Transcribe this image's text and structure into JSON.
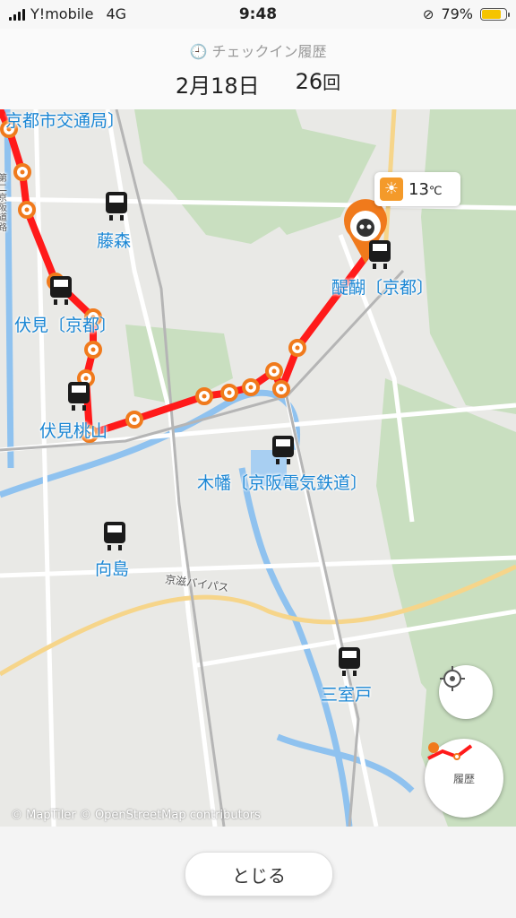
{
  "status": {
    "carrier": "Y!mobile",
    "network": "4G",
    "time": "9:48",
    "battery": "79%",
    "battery_level": 0.79
  },
  "header": {
    "subtitle": "チェックイン履歴",
    "date": "2月18日",
    "count": "26",
    "count_unit": "回"
  },
  "map": {
    "labels": {
      "kyoto_kotsu": "京都市交通局〕",
      "fujinomori": "藤森",
      "fushimi_kyoto": "伏見〔京都〕",
      "fushimi_momoyama": "伏見桃山",
      "daigo": "醍醐〔京都〕",
      "kowata": "木幡〔京阪電気鉄道〕",
      "mukaijima": "向島",
      "mimurodo": "三室戸",
      "bypass": "京滋バイパス",
      "road_side": "第二京阪道路"
    },
    "weather": {
      "icon": "sun-icon",
      "temperature": "13",
      "unit": "℃"
    },
    "route_color": "#ff1a1a",
    "marker_color": "#f07a1c",
    "attribution": "© MapTiler © OpenStreetMap contributors",
    "history_button_label": "履歴"
  },
  "footer": {
    "close_label": "とじる"
  }
}
